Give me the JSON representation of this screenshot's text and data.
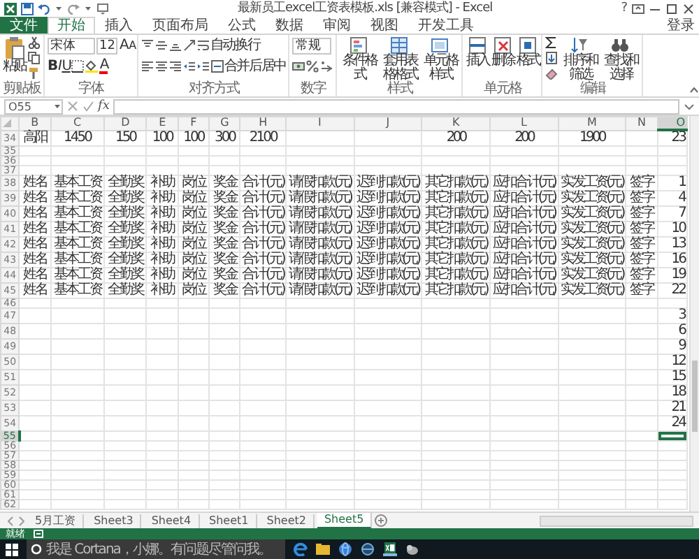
{
  "window": {
    "title": "最新员工excel工资表模板.xls [兼容模式] - Excel",
    "help": "?"
  },
  "ribbon_tabs": [
    {
      "label": "文件",
      "kind": "file",
      "selected": false
    },
    {
      "label": "开始",
      "kind": "tab",
      "selected": true
    },
    {
      "label": "插入",
      "kind": "tab",
      "selected": false
    },
    {
      "label": "页面布局",
      "kind": "tab",
      "selected": false
    },
    {
      "label": "公式",
      "kind": "tab",
      "selected": false
    },
    {
      "label": "数据",
      "kind": "tab",
      "selected": false
    },
    {
      "label": "审阅",
      "kind": "tab",
      "selected": false
    },
    {
      "label": "视图",
      "kind": "tab",
      "selected": false
    },
    {
      "label": "开发工具",
      "kind": "tab",
      "selected": false
    }
  ],
  "sign_in": "登录",
  "ribbon_groups": [
    {
      "kind": "clipboard",
      "label": "剪贴板",
      "buttons": [
        "粘贴"
      ]
    },
    {
      "kind": "font",
      "label": "字体",
      "font_name": "宋体",
      "font_size": "12",
      "grow": "A",
      "shrink": "A",
      "bold": "B",
      "italic": "I",
      "underline": "U",
      "font_color": "A"
    },
    {
      "kind": "alignment",
      "label": "对齐方式",
      "buttons": [
        "自动换行",
        "合并后居中"
      ]
    },
    {
      "kind": "number",
      "label": "数字",
      "format": "常规"
    },
    {
      "kind": "big",
      "label": "样式",
      "buttons": [
        "条件格式",
        "套用表格格式",
        "单元格样式"
      ]
    },
    {
      "kind": "big",
      "label": "单元格",
      "buttons": [
        "插入",
        "删除",
        "格式"
      ]
    },
    {
      "kind": "editing",
      "label": "编辑",
      "buttons": [
        "排序和筛选",
        "查找和选择"
      ]
    }
  ],
  "formula_bar": {
    "name_box": "O55",
    "function_label": "fx"
  },
  "columns": [
    {
      "label": "B",
      "selected": false
    },
    {
      "label": "C",
      "selected": false
    },
    {
      "label": "D",
      "selected": false
    },
    {
      "label": "E",
      "selected": false
    },
    {
      "label": "F",
      "selected": false
    },
    {
      "label": "G",
      "selected": false
    },
    {
      "label": "H",
      "selected": false
    },
    {
      "label": "I",
      "selected": false
    },
    {
      "label": "J",
      "selected": false
    },
    {
      "label": "K",
      "selected": false
    },
    {
      "label": "L",
      "selected": false
    },
    {
      "label": "M",
      "selected": false
    },
    {
      "label": "N",
      "selected": false
    },
    {
      "label": "O",
      "selected": true
    }
  ],
  "rows": [
    {
      "number": "34",
      "selected": false,
      "cells": [
        "高阳",
        "1450",
        "150",
        "100",
        "100",
        "300",
        "2100",
        null,
        null,
        "200",
        "200",
        "1900",
        null,
        "23"
      ]
    },
    {
      "number": "35",
      "selected": false
    },
    {
      "number": "36",
      "selected": false
    },
    {
      "number": "37",
      "selected": false
    },
    {
      "number": "38",
      "selected": false,
      "cells": [
        "姓名",
        "基本工资",
        "全勤奖",
        "补助",
        "岗位",
        "奖金",
        "合计(元)",
        "请假扣款(元)",
        "迟到扣款(元)",
        "其它扣款(元)",
        "应扣合计(元)",
        "实发工资(元)",
        "签字",
        "1"
      ]
    },
    {
      "number": "39",
      "selected": false,
      "cells": [
        "姓名",
        "基本工资",
        "全勤奖",
        "补助",
        "岗位",
        "奖金",
        "合计(元)",
        "请假扣款(元)",
        "迟到扣款(元)",
        "其它扣款(元)",
        "应扣合计(元)",
        "实发工资(元)",
        "签字",
        "4"
      ]
    },
    {
      "number": "40",
      "selected": false,
      "cells": [
        "姓名",
        "基本工资",
        "全勤奖",
        "补助",
        "岗位",
        "奖金",
        "合计(元)",
        "请假扣款(元)",
        "迟到扣款(元)",
        "其它扣款(元)",
        "应扣合计(元)",
        "实发工资(元)",
        "签字",
        "7"
      ]
    },
    {
      "number": "41",
      "selected": false,
      "cells": [
        "姓名",
        "基本工资",
        "全勤奖",
        "补助",
        "岗位",
        "奖金",
        "合计(元)",
        "请假扣款(元)",
        "迟到扣款(元)",
        "其它扣款(元)",
        "应扣合计(元)",
        "实发工资(元)",
        "签字",
        "10"
      ]
    },
    {
      "number": "42",
      "selected": false,
      "cells": [
        "姓名",
        "基本工资",
        "全勤奖",
        "补助",
        "岗位",
        "奖金",
        "合计(元)",
        "请假扣款(元)",
        "迟到扣款(元)",
        "其它扣款(元)",
        "应扣合计(元)",
        "实发工资(元)",
        "签字",
        "13"
      ]
    },
    {
      "number": "43",
      "selected": false,
      "cells": [
        "姓名",
        "基本工资",
        "全勤奖",
        "补助",
        "岗位",
        "奖金",
        "合计(元)",
        "请假扣款(元)",
        "迟到扣款(元)",
        "其它扣款(元)",
        "应扣合计(元)",
        "实发工资(元)",
        "签字",
        "16"
      ]
    },
    {
      "number": "44",
      "selected": false,
      "cells": [
        "姓名",
        "基本工资",
        "全勤奖",
        "补助",
        "岗位",
        "奖金",
        "合计(元)",
        "请假扣款(元)",
        "迟到扣款(元)",
        "其它扣款(元)",
        "应扣合计(元)",
        "实发工资(元)",
        "签字",
        "19"
      ]
    },
    {
      "number": "45",
      "selected": false,
      "cells": [
        "姓名",
        "基本工资",
        "全勤奖",
        "补助",
        "岗位",
        "奖金",
        "合计(元)",
        "请假扣款(元)",
        "迟到扣款(元)",
        "其它扣款(元)",
        "应扣合计(元)",
        "实发工资(元)",
        "签字",
        "22"
      ]
    },
    {
      "number": "46",
      "selected": false
    },
    {
      "number": "47",
      "selected": false,
      "cells": [
        null,
        null,
        null,
        null,
        null,
        null,
        null,
        null,
        null,
        null,
        null,
        null,
        null,
        "3"
      ]
    },
    {
      "number": "48",
      "selected": false,
      "cells": [
        null,
        null,
        null,
        null,
        null,
        null,
        null,
        null,
        null,
        null,
        null,
        null,
        null,
        "6"
      ]
    },
    {
      "number": "49",
      "selected": false,
      "cells": [
        null,
        null,
        null,
        null,
        null,
        null,
        null,
        null,
        null,
        null,
        null,
        null,
        null,
        "9"
      ]
    },
    {
      "number": "50",
      "selected": false,
      "cells": [
        null,
        null,
        null,
        null,
        null,
        null,
        null,
        null,
        null,
        null,
        null,
        null,
        null,
        "12"
      ]
    },
    {
      "number": "51",
      "selected": false,
      "cells": [
        null,
        null,
        null,
        null,
        null,
        null,
        null,
        null,
        null,
        null,
        null,
        null,
        null,
        "15"
      ]
    },
    {
      "number": "52",
      "selected": false,
      "cells": [
        null,
        null,
        null,
        null,
        null,
        null,
        null,
        null,
        null,
        null,
        null,
        null,
        null,
        "18"
      ]
    },
    {
      "number": "53",
      "selected": false,
      "cells": [
        null,
        null,
        null,
        null,
        null,
        null,
        null,
        null,
        null,
        null,
        null,
        null,
        null,
        "21"
      ]
    },
    {
      "number": "54",
      "selected": false,
      "cells": [
        null,
        null,
        null,
        null,
        null,
        null,
        null,
        null,
        null,
        null,
        null,
        null,
        null,
        "24"
      ]
    },
    {
      "number": "55",
      "selected": true
    },
    {
      "number": "56",
      "selected": false
    },
    {
      "number": "57",
      "selected": false
    },
    {
      "number": "58",
      "selected": false
    },
    {
      "number": "59",
      "selected": false
    },
    {
      "number": "60",
      "selected": false
    },
    {
      "number": "61",
      "selected": false
    },
    {
      "number": "62",
      "selected": false
    }
  ],
  "sheet_tabs": [
    {
      "label": "5月工资",
      "selected": false
    },
    {
      "label": "Sheet3",
      "selected": false
    },
    {
      "label": "Sheet4",
      "selected": false
    },
    {
      "label": "Sheet1",
      "selected": false
    },
    {
      "label": "Sheet2",
      "selected": false
    },
    {
      "label": "Sheet5",
      "selected": true
    }
  ],
  "status_bar": {
    "text": "就绪"
  },
  "taskbar": {
    "search": {
      "placeholder": "我是 Cortana，小娜。有问题尽管问我。"
    }
  }
}
